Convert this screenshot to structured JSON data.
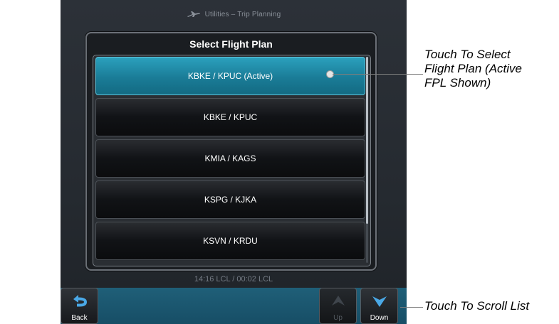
{
  "header": {
    "title": "Utilities – Trip Planning",
    "icon": "airplane-icon"
  },
  "dialog": {
    "title": "Select Flight Plan",
    "items": [
      {
        "label": "KBKE / KPUC (Active)",
        "active": true
      },
      {
        "label": "KBKE / KPUC",
        "active": false
      },
      {
        "label": "KMIA / KAGS",
        "active": false
      },
      {
        "label": "KSPG / KJKA",
        "active": false
      },
      {
        "label": "KSVN / KRDU",
        "active": false
      }
    ]
  },
  "status": {
    "text": "14:16 LCL / 00:02 LCL"
  },
  "footer": {
    "back_label": "Back",
    "up_label": "Up",
    "down_label": "Down"
  },
  "annotations": {
    "select": "Touch To Select\nFlight Plan (Active\nFPL Shown)",
    "scroll": "Touch To Scroll List"
  },
  "colors": {
    "active_item": "#1a7c97",
    "footer_bar": "#174e66",
    "screen_bg": "#252a30"
  }
}
